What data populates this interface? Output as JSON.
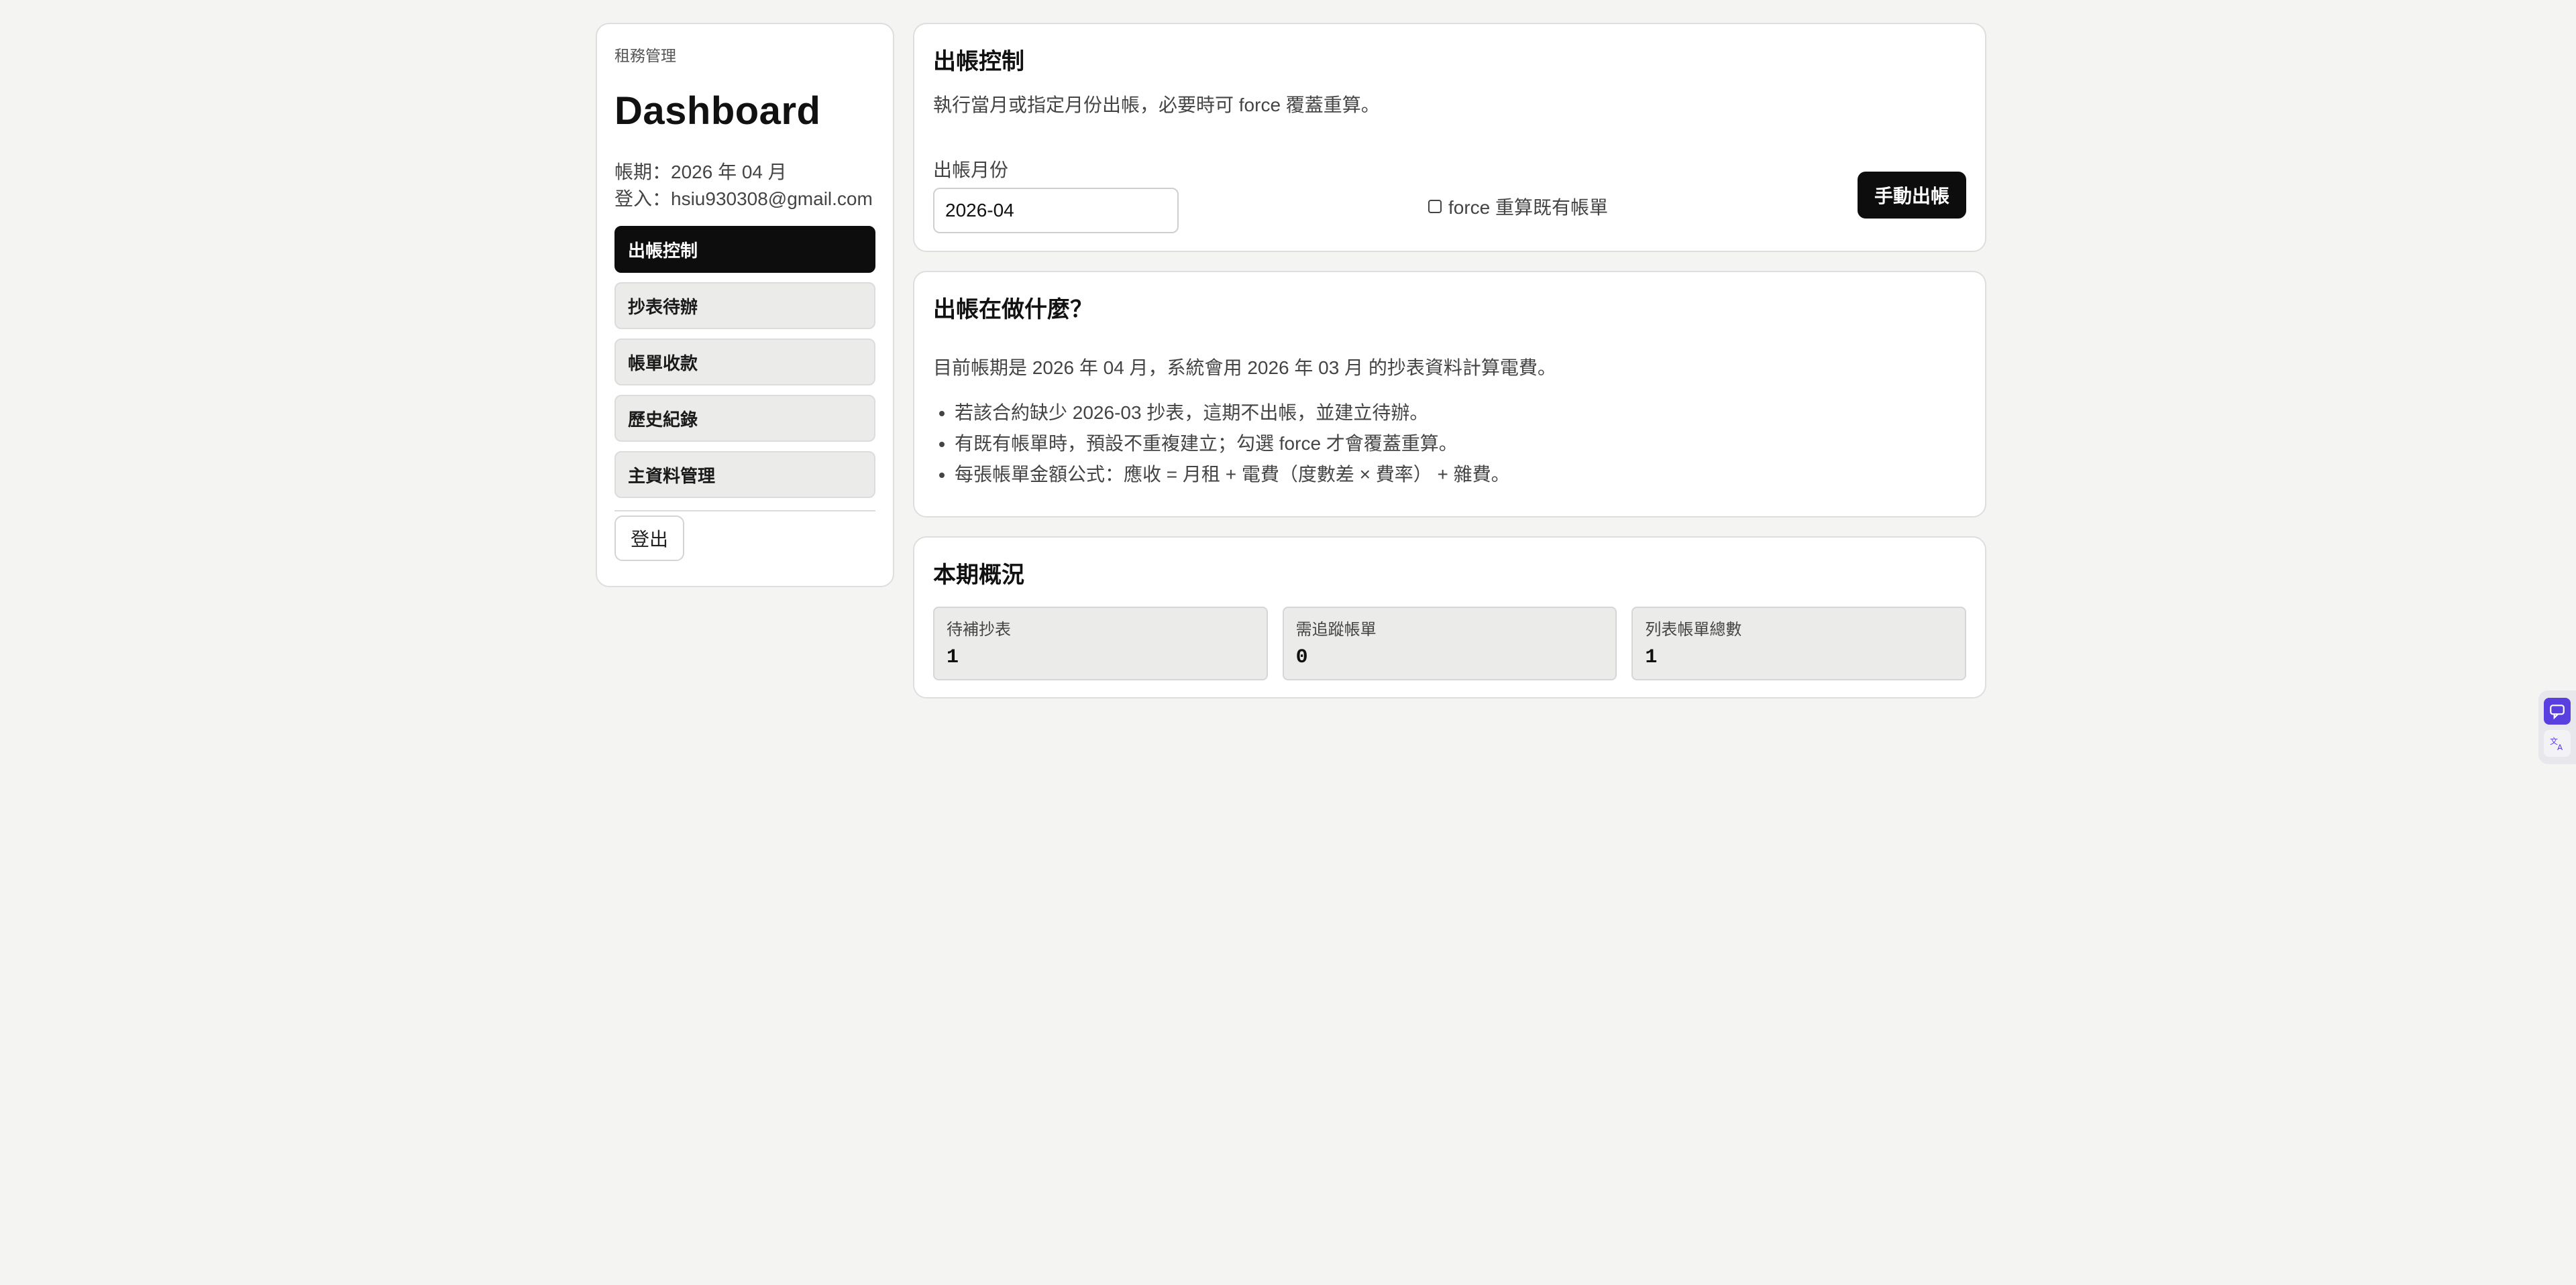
{
  "sidebar": {
    "brand": "租務管理",
    "title": "Dashboard",
    "period_line": "帳期：2026 年 04 月",
    "login_line": "登入：hsiu930308@gmail.com",
    "items": [
      {
        "label": "出帳控制",
        "active": true
      },
      {
        "label": "抄表待辦",
        "active": false
      },
      {
        "label": "帳單收款",
        "active": false
      },
      {
        "label": "歷史紀錄",
        "active": false
      },
      {
        "label": "主資料管理",
        "active": false
      }
    ],
    "logout_label": "登出"
  },
  "billing": {
    "title": "出帳控制",
    "description": "執行當月或指定月份出帳，必要時可 force 覆蓋重算。",
    "month_label": "出帳月份",
    "month_value": "2026-04",
    "force_label": "force 重算既有帳單",
    "force_checked": false,
    "button_label": "手動出帳"
  },
  "explain": {
    "title": "出帳在做什麼？",
    "lead": "目前帳期是 2026 年 04 月，系統會用 2026 年 03 月 的抄表資料計算電費。",
    "bullets": [
      "若該合約缺少 2026-03 抄表，這期不出帳，並建立待辦。",
      "有既有帳單時，預設不重複建立；勾選 force 才會覆蓋重算。",
      "每張帳單金額公式：應收 = 月租 + 電費（度數差 × 費率） + 雜費。"
    ]
  },
  "overview": {
    "title": "本期概況",
    "stats": [
      {
        "label": "待補抄表",
        "value": "1"
      },
      {
        "label": "需追蹤帳單",
        "value": "0"
      },
      {
        "label": "列表帳單總數",
        "value": "1"
      }
    ]
  },
  "widgets": {
    "primary_icon": "chat-bubble-icon",
    "secondary_icon": "translate-icon",
    "primary_color": "#5a3fe0"
  }
}
